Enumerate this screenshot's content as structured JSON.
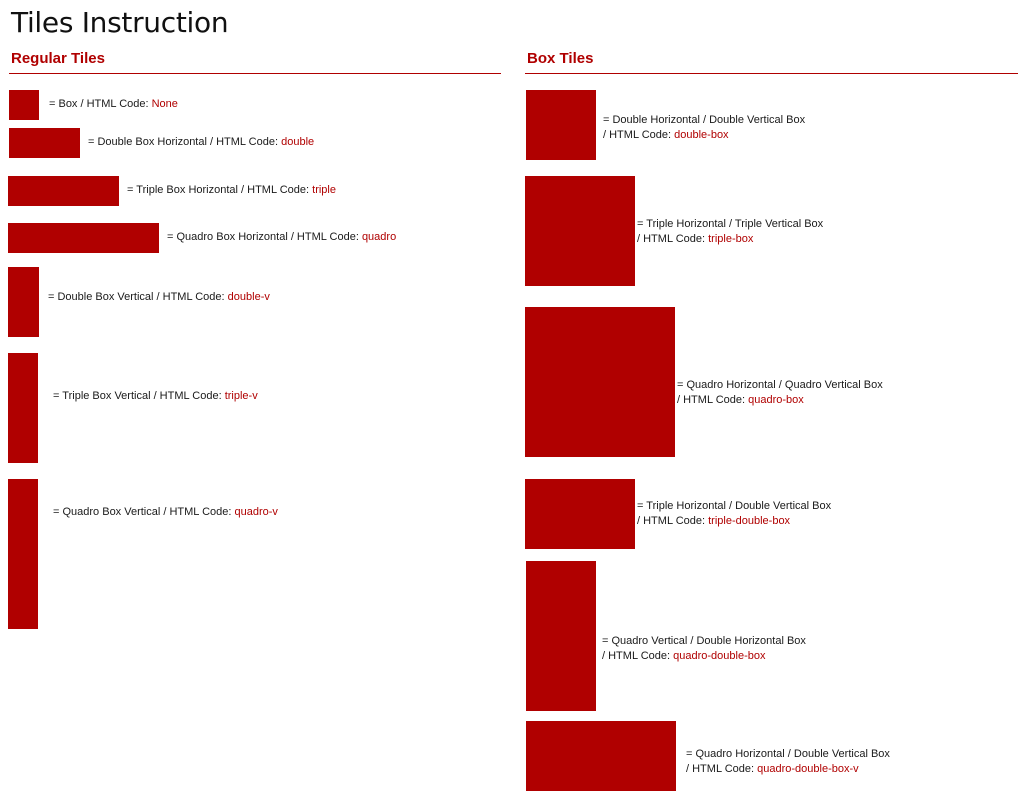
{
  "page": {
    "title": "Tiles Instruction"
  },
  "colors": {
    "accent": "#b00000",
    "text": "#1a1a1a",
    "background": "#ffffff"
  },
  "regular": {
    "title": "Regular Tiles",
    "items": [
      {
        "label": "= Box / HTML Code: ",
        "code": "None"
      },
      {
        "label": "= Double Box Horizontal / HTML Code: ",
        "code": "double"
      },
      {
        "label": "= Triple Box Horizontal / HTML Code: ",
        "code": "triple"
      },
      {
        "label": "= Quadro Box Horizontal / HTML Code: ",
        "code": "quadro"
      },
      {
        "label": "= Double Box Vertical / HTML Code: ",
        "code": "double-v"
      },
      {
        "label": "= Triple Box Vertical / HTML Code: ",
        "code": "triple-v"
      },
      {
        "label": "= Quadro Box Vertical / HTML Code: ",
        "code": "quadro-v"
      }
    ]
  },
  "box": {
    "title": "Box Tiles",
    "items": [
      {
        "line1": "= Double Horizontal /  Double Vertical  Box",
        "line2": "/ HTML Code: ",
        "code": "double-box"
      },
      {
        "line1": "= Triple Horizontal /   Triple Vertical  Box",
        "line2": "/ HTML Code: ",
        "code": "triple-box"
      },
      {
        "line1": "= Quadro Horizontal /  Quadro Vertical  Box",
        "line2": "/ HTML Code: ",
        "code": "quadro-box"
      },
      {
        "line1": "= Triple Horizontal /   Double Vertical  Box",
        "line2": "/ HTML Code: ",
        "code": "triple-double-box"
      },
      {
        "line1": "= Quadro Vertical /   Double Horizontal Box",
        "line2": "/ HTML Code: ",
        "code": "quadro-double-box"
      },
      {
        "line1": "= Quadro Horizontal / Double Vertical Box",
        "line2": "/ HTML Code: ",
        "code": "quadro-double-box-v"
      }
    ]
  }
}
